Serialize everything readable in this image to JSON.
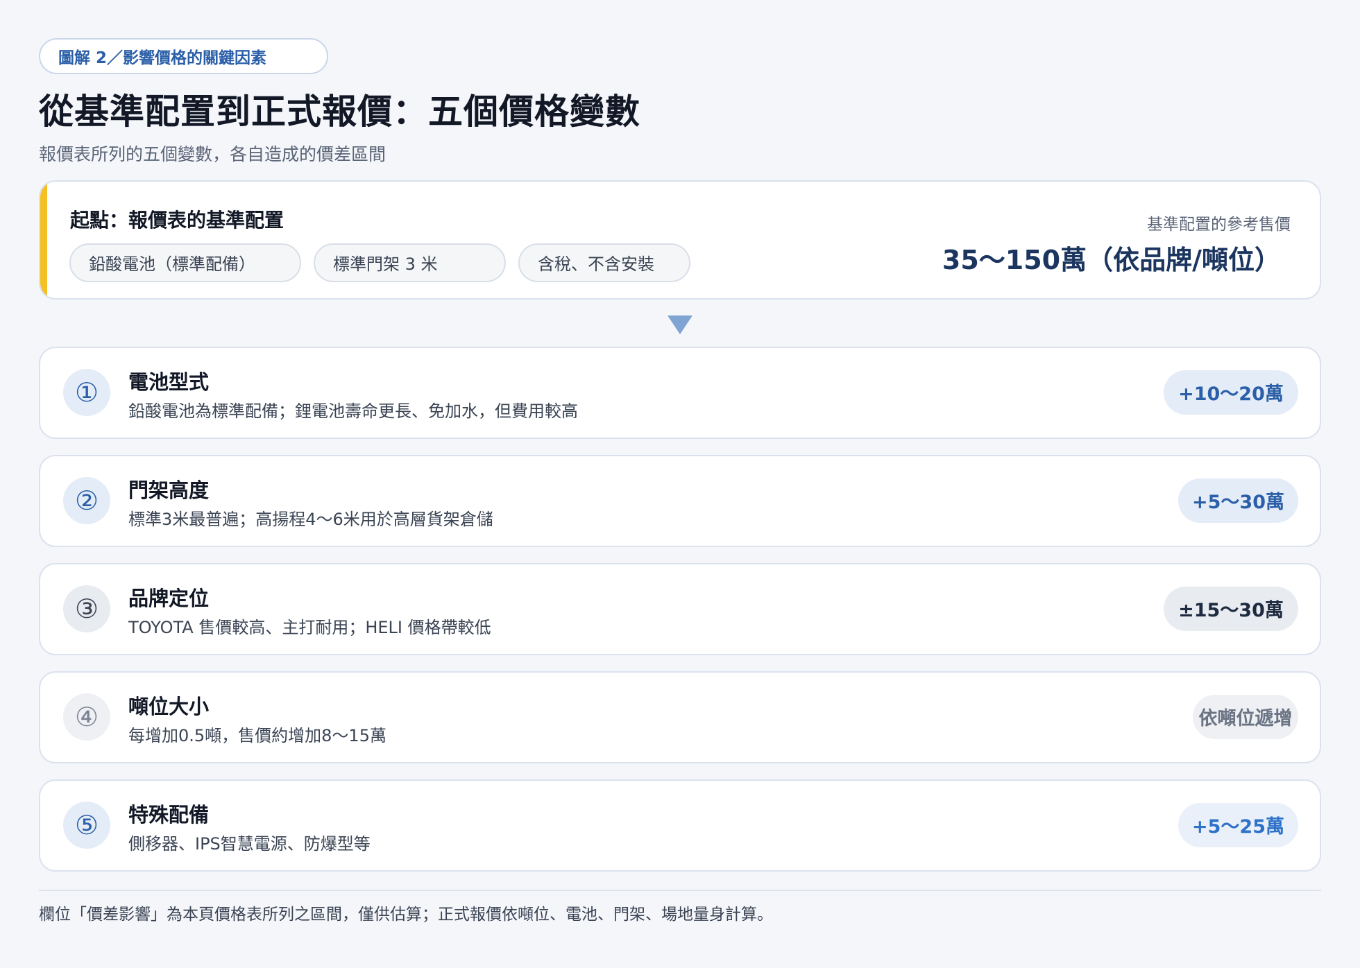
{
  "tag": "圖解 2／影響價格的關鍵因素",
  "title": "從基準配置到正式報價：五個價格變數",
  "subtitle": "報價表所列的五個變數，各自造成的價差區間",
  "base": {
    "label": "起點：報價表的基準配置",
    "chips": [
      "鉛酸電池（標準配備）",
      "標準門架 3 米",
      "含稅、不含安裝"
    ],
    "ref_label": "基準配置的參考售價",
    "ref_value": "35～150萬（依品牌/噸位）",
    "accent_color": "#f5c023"
  },
  "factors": [
    {
      "num": "①",
      "title": "電池型式",
      "desc": "鉛酸電池為標準配備；鋰電池壽命更長、免加水，但費用較高",
      "impact": "+10～20萬"
    },
    {
      "num": "②",
      "title": "門架高度",
      "desc": "標準3米最普遍；高揚程4～6米用於高層貨架倉儲",
      "impact": "+5～30萬"
    },
    {
      "num": "③",
      "title": "品牌定位",
      "desc": "TOYOTA 售價較高、主打耐用；HELI 價格帶較低",
      "impact": "±15～30萬"
    },
    {
      "num": "④",
      "title": "噸位大小",
      "desc": "每增加0.5噸，售價約增加8～15萬",
      "impact": "依噸位遞增"
    },
    {
      "num": "⑤",
      "title": "特殊配備",
      "desc": "側移器、IPS智慧電源、防爆型等",
      "impact": "+5～25萬"
    }
  ],
  "footer": "欄位「價差影響」為本頁價格表所列之區間，僅供估算；正式報價依噸位、電池、門架、場地量身計算。"
}
